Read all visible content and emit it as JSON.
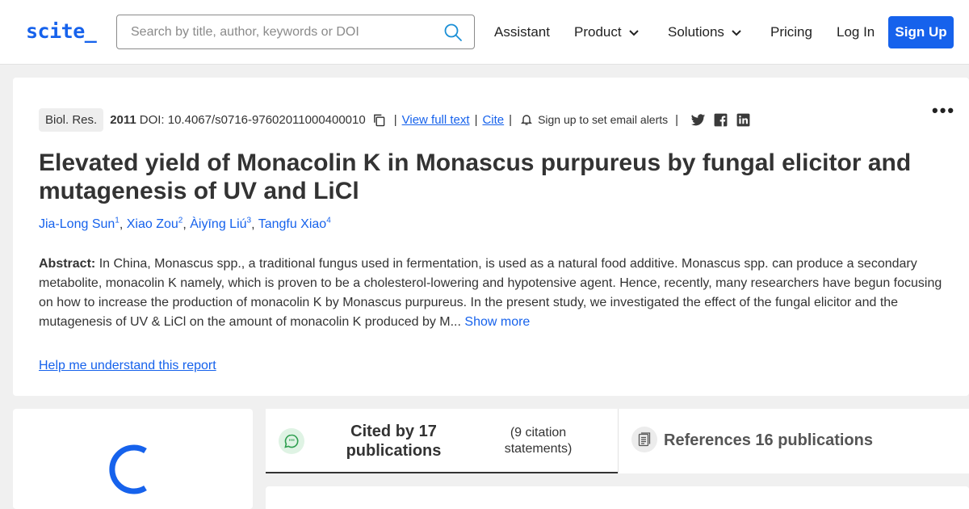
{
  "header": {
    "logo": "scite_",
    "search_placeholder": "Search by title, author, keywords or DOI",
    "nav": {
      "assistant": "Assistant",
      "product": "Product",
      "solutions": "Solutions",
      "pricing": "Pricing",
      "login": "Log In",
      "signup": "Sign Up"
    }
  },
  "paper": {
    "journal": "Biol. Res.",
    "year": "2011",
    "doi": "DOI: 10.4067/s0716-97602011000400010",
    "view_full_text": "View full text",
    "cite": "Cite",
    "alerts": "Sign up to set email alerts",
    "title": "Elevated yield of Monacolin K in Monascus purpureus by fungal elicitor and mutagenesis of UV and LiCl",
    "authors": [
      {
        "name": "Jia-Long Sun",
        "sup": "1"
      },
      {
        "name": "Xiao Zou",
        "sup": "2"
      },
      {
        "name": "Àiyīng Liú",
        "sup": "3"
      },
      {
        "name": "Tangfu Xiao",
        "sup": "4"
      }
    ],
    "abstract_label": "Abstract:",
    "abstract_text": "In China, Monascus spp., a traditional fungus used in fermentation, is used as a natural food additive. Monascus spp. can produce a secondary metabolite, monacolin K namely, which is proven to be a cholesterol-lowering and hypotensive agent. Hence, recently, many researchers have begun focusing on how to increase the production of monacolin K by Monascus purpureus. In the present study, we investigated the effect of the fungal elicitor and the mutagenesis of UV & LiCl on the amount of monacolin K produced by M...",
    "show_more": "Show more",
    "help_link": "Help me understand this report"
  },
  "tabs": {
    "cited_label": "Cited by 17 publications",
    "cited_sub": "(9 citation statements)",
    "references_label": "References 16 publications"
  },
  "colors": {
    "brand": "#1662ec",
    "cited_badge": "#2e9e4f"
  }
}
